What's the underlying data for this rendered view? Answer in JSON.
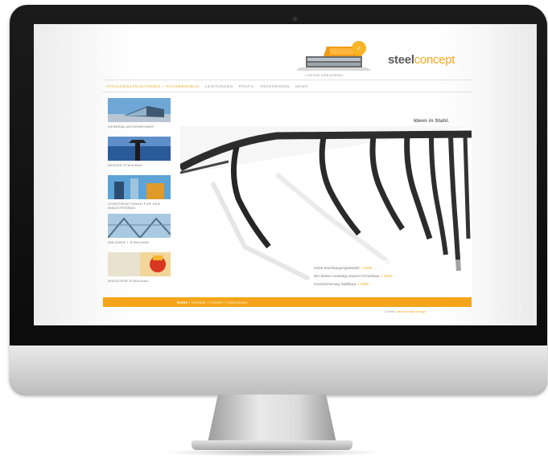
{
  "brand": {
    "name_part1": "steel",
    "name_part2": "concept",
    "tagline": "+ PETER GREGORSKI"
  },
  "nav": {
    "items": [
      "Stahlkonstruktionen + Fachwerkbau",
      "Leistungen",
      "Profil",
      "Referenzen",
      "News"
    ]
  },
  "sidebar": {
    "items": [
      {
        "label": "Generalunternehmer"
      },
      {
        "label": "Design Stahlbau"
      },
      {
        "label": "Construktionen fur den Industriebau"
      },
      {
        "label": "Anlagen + Stahlbau"
      },
      {
        "label": "Industrie Stahlbau"
      }
    ]
  },
  "hero": {
    "title": "Ideen in Stahl.",
    "news": [
      {
        "text": "Hohe Dachbauprojektstahl",
        "more": "» mehr ..."
      },
      {
        "text": "Wir bieten Ausstieg neuem Firmenbau",
        "more": "» mehr ..."
      },
      {
        "text": "Hochsicherung Stahlbau",
        "more": "» mehr ..."
      }
    ]
  },
  "footer": {
    "links": [
      "home",
      "Kontakt",
      "Anfahrt",
      "Impressum"
    ],
    "credits_text": "Credits:",
    "credits_accent": "steelconcept Design"
  },
  "colors": {
    "accent": "#f0a81e",
    "footer": "#f4a51a"
  }
}
